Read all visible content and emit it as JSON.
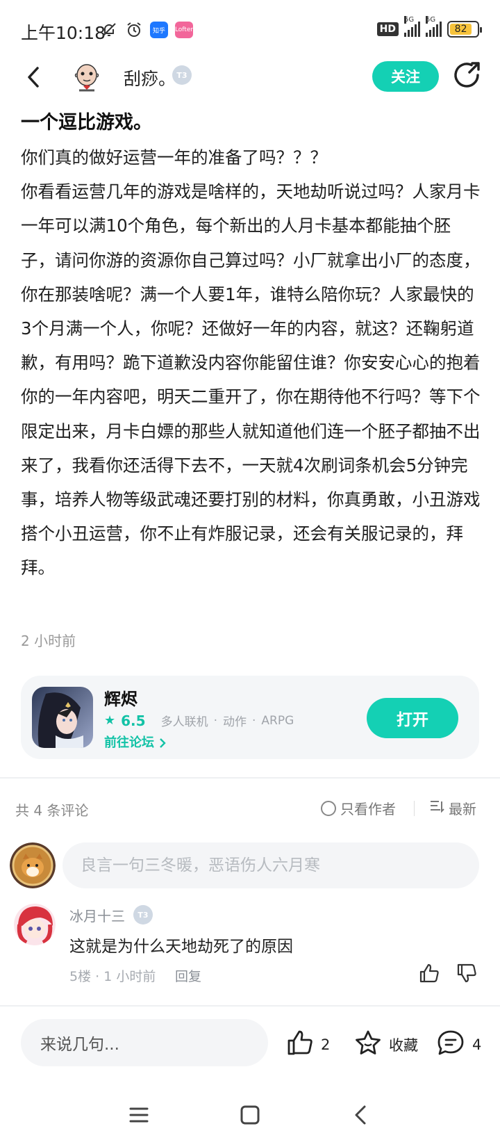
{
  "status_bar": {
    "time": "上午10:18",
    "app_badges": [
      "知乎",
      "Lofter"
    ],
    "hd": "HD",
    "net1": "5G",
    "net2": "5G",
    "battery": "82"
  },
  "header": {
    "username": "刮痧。",
    "level": "T3",
    "follow_label": "关注"
  },
  "post": {
    "title": "一个逗比游戏。",
    "paragraphs": [
      "你们真的做好运营一年的准备了吗？？？",
      "你看看运营几年的游戏是啥样的，天地劫听说过吗？人家月卡一年可以满10个角色，每个新出的人月卡基本都能抽个胚子，请问你游的资源你自己算过吗？小厂就拿出小厂的态度，你在那装啥呢？满一个人要1年，谁特么陪你玩？人家最快的3个月满一个人，你呢？还做好一年的内容，就这？还鞠躬道歉，有用吗？跪下道歉没内容你能留住谁？你安安心心的抱着你的一年内容吧，明天二重开了，你在期待他不行吗？等下个限定出来，月卡白嫖的那些人就知道他们连一个胚子都抽不出来了，我看你还活得下去不，一天就4次刷词条机会5分钟完事，培养人物等级武魂还要打别的材料，你真勇敢，小丑游戏搭个小丑运营，你不止有炸服记录，还会有关服记录的，拜拜。"
    ],
    "time_ago": "2 小时前"
  },
  "game_card": {
    "name": "辉烬",
    "score": "6.5",
    "tags": [
      "多人联机",
      "动作",
      "ARPG"
    ],
    "forum_link": "前往论坛",
    "open_label": "打开"
  },
  "comments": {
    "count_label": "共 4 条评论",
    "only_author_label": "只看作者",
    "sort_label": "最新",
    "input_placeholder": "良言一句三冬暖，恶语伤人六月寒",
    "items": [
      {
        "user": "冰月十三",
        "level": "T3",
        "text": "这就是为什么天地劫死了的原因",
        "meta": "5楼 · 1 小时前",
        "reply_label": "回复"
      }
    ]
  },
  "bottom_bar": {
    "input_label": "来说几句...",
    "like_count": "2",
    "collect_label": "收藏",
    "comment_count": "4"
  },
  "colors": {
    "accent": "#14d0b4",
    "accent_text": "#12c2a6",
    "muted": "#999999"
  }
}
